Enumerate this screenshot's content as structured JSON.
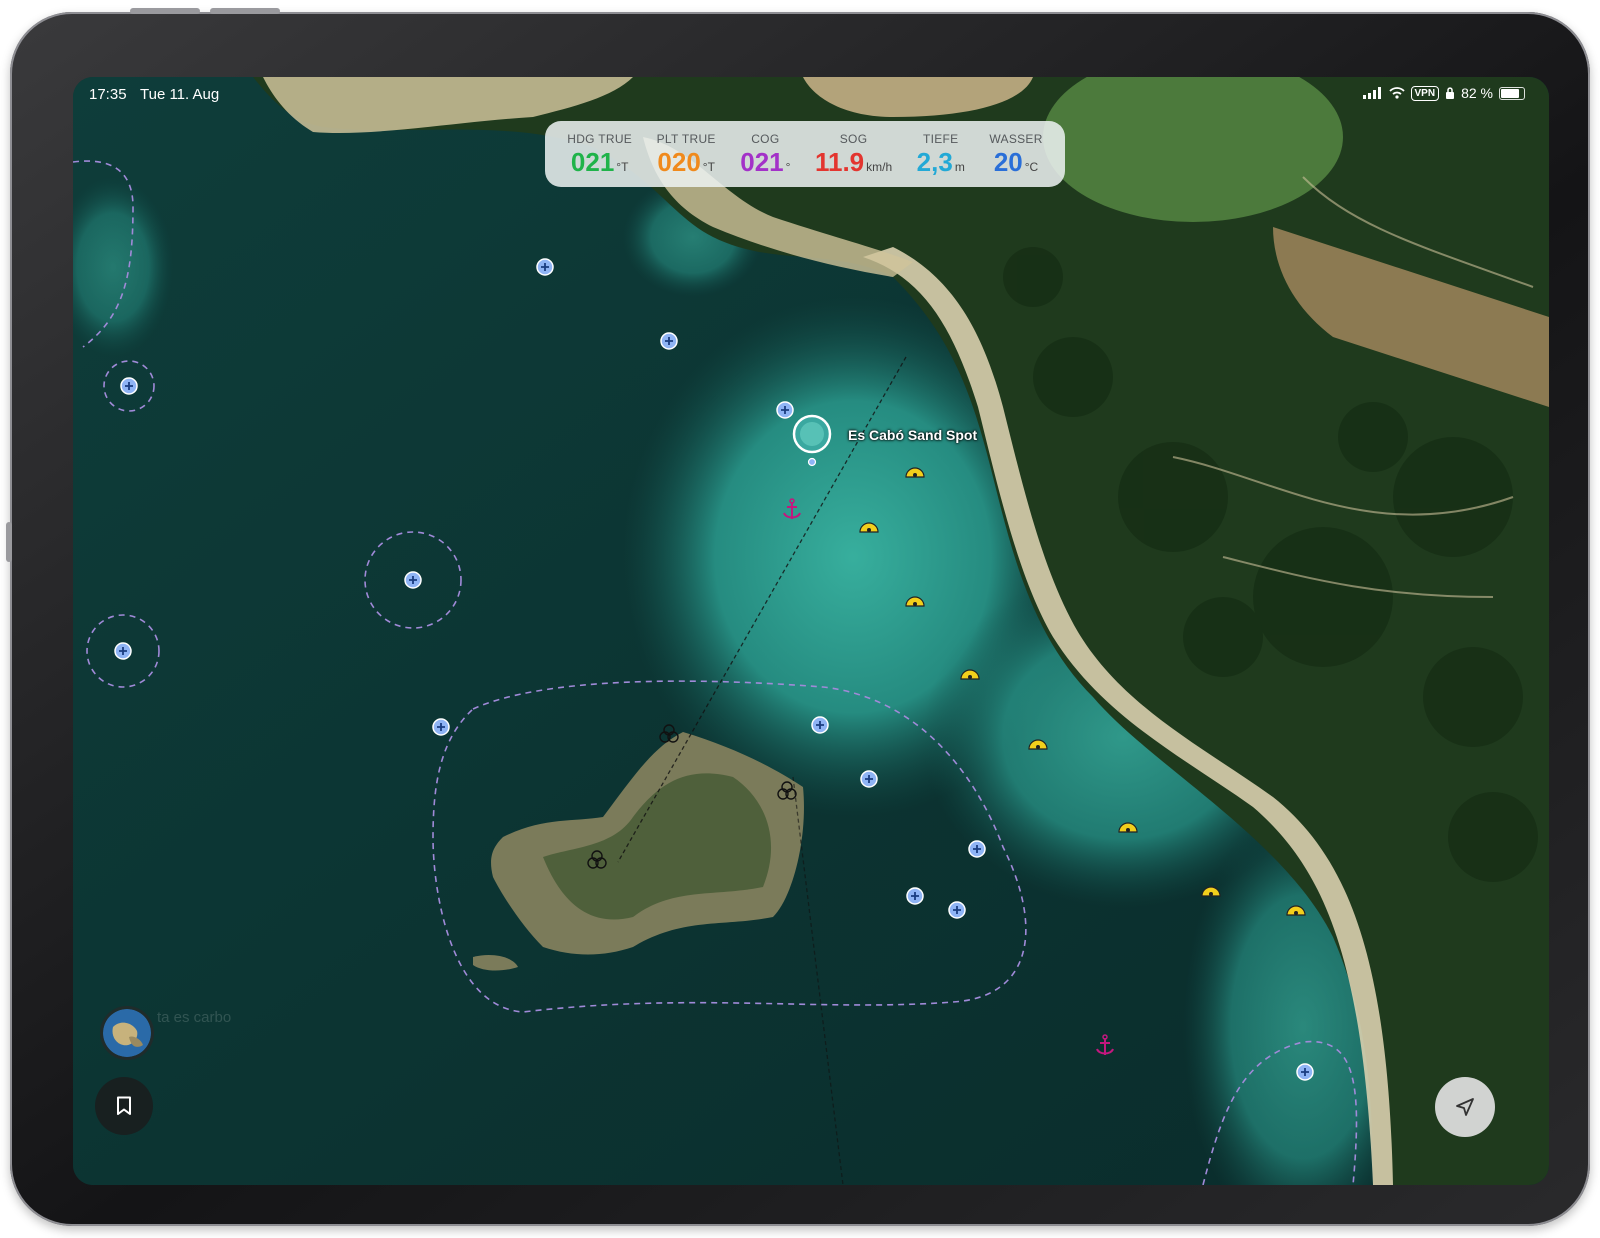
{
  "status_bar": {
    "time": "17:35",
    "date": "Tue 11. Aug",
    "vpn": "VPN",
    "battery": "82 %"
  },
  "instruments": [
    {
      "label": "HDG TRUE",
      "value": "021",
      "unit": "°T",
      "color": "#1fb34a"
    },
    {
      "label": "PLT TRUE",
      "value": "020",
      "unit": "°T",
      "color": "#f08a1c"
    },
    {
      "label": "COG",
      "value": "021",
      "unit": "°",
      "color": "#a331c8"
    },
    {
      "label": "SOG",
      "value": "11.9",
      "unit": "km/h",
      "color": "#e3352f"
    },
    {
      "label": "TIEFE",
      "value": "2,3",
      "unit": "m",
      "color": "#23a9d6"
    },
    {
      "label": "WASSER",
      "value": "20",
      "unit": "°C",
      "color": "#2a6fd8"
    }
  ],
  "map": {
    "poi_label": "Es Cabó Sand Spot",
    "left_thumb_label": "ta es carbo",
    "colors": {
      "dive_marker": "#8fb4f5",
      "buoy": "#f2cf1c",
      "anchor": "#c2187e",
      "zone_line": "#a08ad8"
    }
  },
  "icons": {
    "bookmark": "bookmark-icon",
    "locate": "location-arrow-icon"
  }
}
